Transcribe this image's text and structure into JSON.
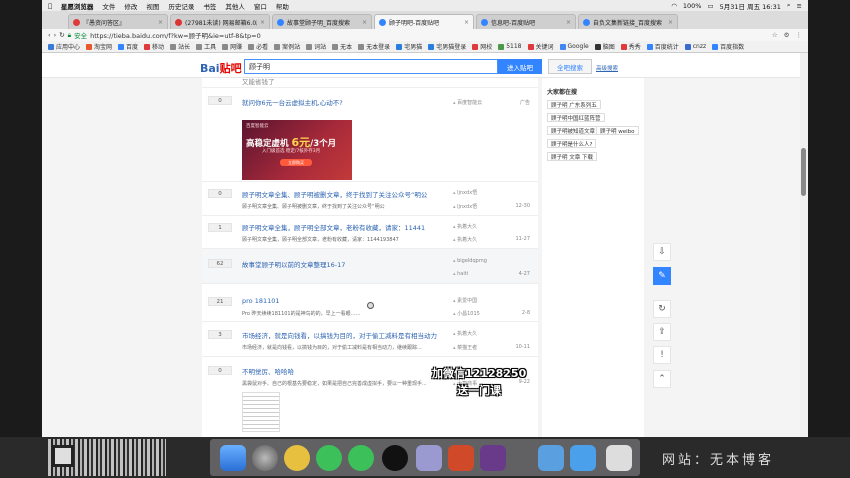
{
  "menubar": {
    "app": "星愿浏览器",
    "items": [
      "文件",
      "修改",
      "视图",
      "历史记录",
      "书签",
      "其他人",
      "窗口",
      "帮助"
    ],
    "battery": "100%",
    "datetime": "5月31日 周五 16:31"
  },
  "tabs": [
    {
      "label": "『愚资问答区』",
      "color": "#e03a3a"
    },
    {
      "label": "(27981未读) 网易邮箱6.0版",
      "color": "#d33"
    },
    {
      "label": "故事堂顾子明_百度搜索",
      "color": "#3385ff"
    },
    {
      "label": "顾子明吧-百度贴吧",
      "color": "#3385ff",
      "active": true
    },
    {
      "label": "信息吧-百度贴吧",
      "color": "#3385ff"
    },
    {
      "label": "自负文集新链接_百度搜索",
      "color": "#3385ff"
    }
  ],
  "address": {
    "secure_label": "安全",
    "url": "https://tieba.baidu.com/f?kw=顾子明&ie=utf-8&tp=0"
  },
  "bookmarks": [
    "应用中心",
    "淘宝网",
    "百度",
    "移动",
    "站长",
    "工具",
    "网赚",
    "必看",
    "案例站",
    "词站",
    "无本",
    "无本登录",
    "宅男猫",
    "宅男猫登录",
    "网校",
    "5118",
    "关键词",
    "Google",
    "脑图",
    "秀秀",
    "百度统计",
    "cnzz",
    "百度指数"
  ],
  "search": {
    "logo_text": "Bai",
    "logo_accent": "贴吧",
    "query": "顾子明",
    "enter_label": "进入贴吧",
    "full_label": "全吧搜索",
    "advanced_label": "高级搜索"
  },
  "threads": [
    {
      "reply": "",
      "title": "又能省钱了",
      "author": "",
      "time": ""
    },
    {
      "reply": "0",
      "title": "就问你6元一台云虚拟主机,心动不?",
      "author": "百度智能云",
      "time": "广告"
    },
    {
      "reply": "0",
      "title": "顾子明文章全集、顾子明被删文章，终于找到了关注公众号“明公",
      "abstract": "顾子明文章全集、顾子明被删文章，终于找到了关注公众号“明公",
      "author": "ljnxdx悟",
      "author2": "ljnxdx悟",
      "time": "12-30"
    },
    {
      "reply": "1",
      "title": "顾子明文章全集，顾子明全部文章，老粉有收藏，请家：11441",
      "abstract": "顾子明文章全集，顾子明全部文章，老粉有收藏，请家：1144193847",
      "author": "执着大久",
      "author2": "执着大久",
      "time": "11-27"
    },
    {
      "reply": "62",
      "title": "故事堂顾子明以前的文章整理16-17",
      "author": "bigeldqpmg",
      "author2": "haiti",
      "time": "4-27"
    },
    {
      "reply": "21",
      "title": "pro 181101",
      "abstract": "Pro 昨天续续181101的是神鸟的的，早上一看眼……",
      "author": "素爱中国",
      "author2": "小昌1015",
      "time": "2-8"
    },
    {
      "reply": "3",
      "title": "市场经济，就是向钱看，以搞钱为目的，对于偷工减料是有相当动力",
      "abstract": "市场经济，就是向钱看，以搞钱为目的，对于偷工减料是有相当动力，继续跟踪...",
      "author": "执着大久",
      "author2": "菜猫王者",
      "time": "10-11"
    },
    {
      "reply": "0",
      "title": "不明觉厉、哈哈哈",
      "abstract": "黑袋鼠对手、自己的根基先要稳定，如果是把自己完善成虚拟手，要以一种重现手...",
      "author": "",
      "author2": "大司商事",
      "time": "9-22"
    }
  ],
  "ad": {
    "brand": "百度智能云",
    "headline_pre": "高稳定虚机",
    "headline_num": "6元",
    "headline_post": "/3个月",
    "sub": "入门级首选  稳定/7核外存3月",
    "button": "立即购买"
  },
  "sidebar": {
    "title": "大家都在搜",
    "keywords": [
      "顾子明 广东系列五",
      "顾子明中国红蓝阵营",
      "顾子明被知道文章",
      "顾子明 weibo",
      "顾子明是什么人?",
      "顾子明 文章 下载"
    ]
  },
  "overlay": {
    "line1": "加微信12128250",
    "line2": "送一门课"
  },
  "dock": {
    "site_text": "网站：无本博客"
  }
}
